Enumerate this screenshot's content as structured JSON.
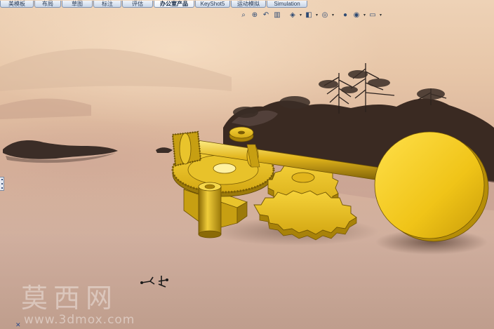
{
  "tabs": [
    {
      "label": "草图",
      "active": false
    },
    {
      "label": "标注",
      "active": false
    },
    {
      "label": "评估",
      "active": false
    },
    {
      "label": "办公室产品",
      "active": true
    },
    {
      "label": "KeyShot5",
      "active": false
    },
    {
      "label": "运动模拟",
      "active": false
    },
    {
      "label": "Simulation",
      "active": false
    }
  ],
  "tab_prefix": [
    "美模板",
    "布局"
  ],
  "view_toolbar": [
    {
      "icon": "zoom-to-fit-icon",
      "glyph": "⌕"
    },
    {
      "icon": "zoom-area-icon",
      "glyph": "⊕"
    },
    {
      "icon": "previous-view-icon",
      "glyph": "↶"
    },
    {
      "icon": "section-view-icon",
      "glyph": "▥"
    },
    {
      "icon": "view-orientation-icon",
      "glyph": "◈",
      "dropdown": true
    },
    {
      "icon": "display-style-icon",
      "glyph": "◧",
      "dropdown": true
    },
    {
      "icon": "hide-show-items-icon",
      "glyph": "◎",
      "dropdown": true
    },
    {
      "icon": "edit-appearance-icon",
      "glyph": "●"
    },
    {
      "icon": "apply-scene-icon",
      "glyph": "◉",
      "dropdown": true
    },
    {
      "icon": "view-settings-icon",
      "glyph": "▭",
      "dropdown": true
    }
  ],
  "watermark": {
    "cn": "莫西网",
    "url": "www.3dmox.com"
  },
  "colors": {
    "gear": "#d9b21a",
    "gear_dark": "#8a6d05",
    "gear_light": "#f4d43a",
    "disc": "#f2cc1c"
  }
}
